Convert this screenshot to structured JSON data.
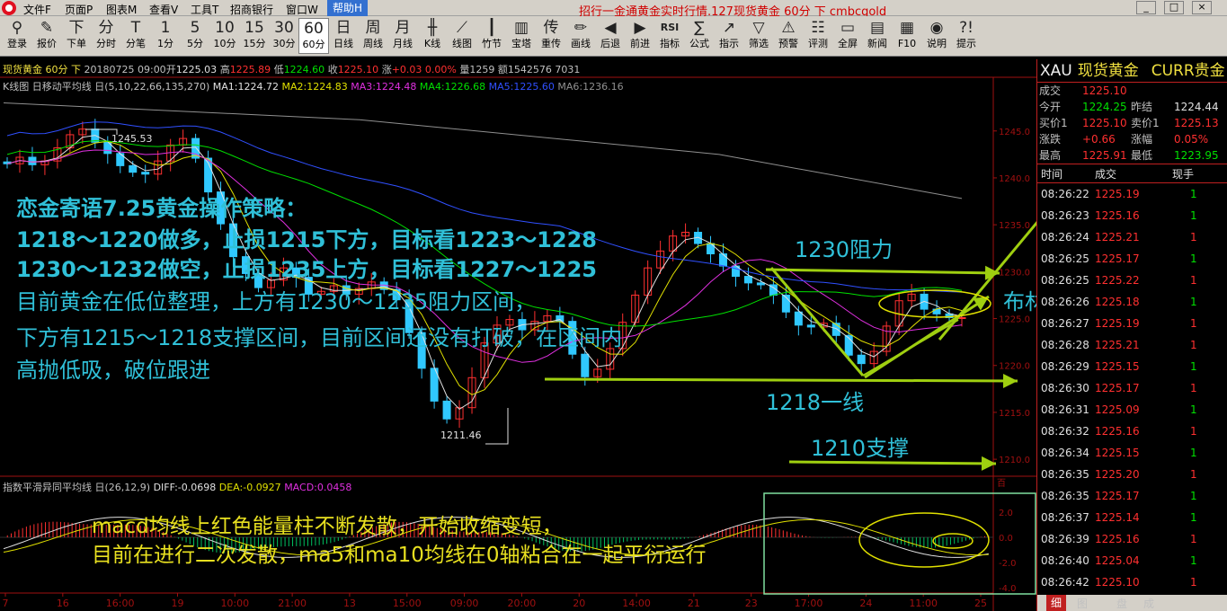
{
  "menubar": {
    "items": [
      "文件F",
      "页面P",
      "图表M",
      "查看V",
      "工具T",
      "招商银行",
      "窗口W"
    ],
    "help": "帮助H",
    "window_title": "招行一金通黄金实时行情.127现货黄金 60分 下 cmbcgold",
    "win_btns": [
      "_",
      "□",
      "×"
    ]
  },
  "toolbar": [
    {
      "icon": "login-icon",
      "glyph": "⚲",
      "label": "登录"
    },
    {
      "icon": "quote-icon",
      "glyph": "✎",
      "label": "报价"
    },
    {
      "icon": "order-icon",
      "glyph": "下",
      "label": "下单"
    },
    {
      "icon": "minute-icon",
      "glyph": "分",
      "label": "分时"
    },
    {
      "icon": "tick-icon",
      "glyph": "T",
      "label": "分笔"
    },
    {
      "icon": "1min-icon",
      "glyph": "1",
      "label": "1分"
    },
    {
      "icon": "5min-icon",
      "glyph": "5",
      "label": "5分"
    },
    {
      "icon": "10min-icon",
      "glyph": "10",
      "label": "10分"
    },
    {
      "icon": "15min-icon",
      "glyph": "15",
      "label": "15分"
    },
    {
      "icon": "30min-icon",
      "glyph": "30",
      "label": "30分"
    },
    {
      "icon": "60min-icon",
      "glyph": "60",
      "label": "60分",
      "active": true
    },
    {
      "icon": "day-icon",
      "glyph": "日",
      "label": "日线"
    },
    {
      "icon": "week-icon",
      "glyph": "周",
      "label": "周线"
    },
    {
      "icon": "month-icon",
      "glyph": "月",
      "label": "月线"
    },
    {
      "icon": "kline-icon",
      "glyph": "╫",
      "label": "K线"
    },
    {
      "icon": "line-icon",
      "glyph": "⟋",
      "label": "线图"
    },
    {
      "icon": "bamboo-icon",
      "glyph": "┃",
      "label": "竹节"
    },
    {
      "icon": "tower-icon",
      "glyph": "▥",
      "label": "宝塔"
    },
    {
      "icon": "retransmit-icon",
      "glyph": "传",
      "label": "重传"
    },
    {
      "icon": "draw-icon",
      "glyph": "✏",
      "label": "画线"
    },
    {
      "icon": "back-icon",
      "glyph": "◀",
      "label": "后退"
    },
    {
      "icon": "forward-icon",
      "glyph": "▶",
      "label": "前进"
    },
    {
      "icon": "indicator-icon",
      "glyph": "RSI",
      "label": "指标"
    },
    {
      "icon": "formula-icon",
      "glyph": "∑",
      "label": "公式"
    },
    {
      "icon": "guide-icon",
      "glyph": "↗",
      "label": "指示"
    },
    {
      "icon": "filter-icon",
      "glyph": "▽",
      "label": "筛选"
    },
    {
      "icon": "alert-icon",
      "glyph": "⚠",
      "label": "预警"
    },
    {
      "icon": "review-icon",
      "glyph": "☷",
      "label": "评测"
    },
    {
      "icon": "fullscreen-icon",
      "glyph": "▭",
      "label": "全屏"
    },
    {
      "icon": "news-icon",
      "glyph": "▤",
      "label": "新闻"
    },
    {
      "icon": "f10-icon",
      "glyph": "▦",
      "label": "F10"
    },
    {
      "icon": "explain-icon",
      "glyph": "◉",
      "label": "说明"
    },
    {
      "icon": "prompt-icon",
      "glyph": "?!",
      "label": "提示"
    }
  ],
  "chart_info": {
    "quote_line": {
      "name": "现货黄金 60分 下",
      "datetime": "20180725 09:00",
      "open_label": "开",
      "open": "1225.03",
      "high_label": "高",
      "high": "1225.89",
      "low_label": "低",
      "low": "1224.60",
      "close_label": "收",
      "close": "1225.10",
      "change_label": "涨",
      "change": "+0.03",
      "pct": "0.00%",
      "vol_label": "量",
      "vol": "1259",
      "amt_label": "额",
      "amt": "1542576",
      "oi": "7031"
    },
    "ma_line": {
      "prefix": "K线图 日移动平均线 日(5,10,22,66,135,270)",
      "ma1": "MA1:1224.72",
      "ma2": "MA2:1224.83",
      "ma3": "MA3:1224.48",
      "ma4": "MA4:1226.68",
      "ma5": "MA5:1225.60",
      "ma6": "MA6:1236.16"
    },
    "macd_line": {
      "prefix": "指数平滑异同平均线 日(26,12,9)",
      "diff": "DIFF:-0.0698",
      "dea": "DEA:-0.0927",
      "macd": "MACD:0.0458"
    }
  },
  "chart_labels": {
    "high_marker": "1245.53",
    "low_marker": "1211.46",
    "price_ticks": [
      "1245.0",
      "1240.0",
      "1235.0",
      "1230.0",
      "1225.0",
      "1220.0",
      "1215.0",
      "1210.0"
    ],
    "macd_ticks": [
      "2.0",
      "0.0",
      "-2.0",
      "-4.0"
    ],
    "macd_unit": "百",
    "x_ticks": [
      "7",
      "16",
      "16:00",
      "19",
      "10:00",
      "21:00",
      "13",
      "15:00",
      "09:00",
      "20:00",
      "20",
      "14:00",
      "21",
      "23",
      "17:00",
      "24",
      "11:00",
      "25"
    ]
  },
  "strategy": [
    "恋金寄语7.25黄金操作策略：",
    "1218～1220做多，止损1215下方，目标看1223～1228",
    "1230～1232做空，止损1235上方，目标看1227～1225",
    "目前黄金在低位整理，上方有1230～1235阻力区间，",
    "下方有1215～1218支撑区间，目前区间还没有打破，在区间内",
    "高抛低吸，破位跟进"
  ],
  "annotations": {
    "resistance": "1230阻力",
    "support_1218": "1218一线",
    "support_1210": "1210支撑",
    "boll": "布林线平行运行"
  },
  "macd_note": [
    "macd均线上红色能量柱不断发散，开始收缩变短，",
    "目前在进行二次发散，ma5和ma10均线在0轴粘合在一起平衍运行"
  ],
  "quote_panel": {
    "code": "XAU",
    "name": "现货黄金",
    "category": "CURR贵金",
    "last_label": "成交",
    "last": "1225.10",
    "open_label": "今开",
    "open": "1224.25",
    "prev_label": "昨结",
    "prev": "1224.44",
    "bid_label": "买价1",
    "bid": "1225.10",
    "ask_label": "卖价1",
    "ask": "1225.13",
    "chg_label": "涨跌",
    "chg": "+0.66",
    "amp_label": "涨幅",
    "amp": "0.05%",
    "high_label": "最高",
    "high": "1225.91",
    "low_label": "最低",
    "low": "1223.95",
    "tick_headers": [
      "时间",
      "成交",
      "现手"
    ],
    "ticks": [
      {
        "time": "08:26:22",
        "price": "1225.19",
        "vol": "1",
        "dir": "green"
      },
      {
        "time": "08:26:23",
        "price": "1225.16",
        "vol": "1",
        "dir": "green"
      },
      {
        "time": "08:26:24",
        "price": "1225.21",
        "vol": "1",
        "dir": "red"
      },
      {
        "time": "08:26:25",
        "price": "1225.17",
        "vol": "1",
        "dir": "green"
      },
      {
        "time": "08:26:25",
        "price": "1225.22",
        "vol": "1",
        "dir": "red"
      },
      {
        "time": "08:26:26",
        "price": "1225.18",
        "vol": "1",
        "dir": "green"
      },
      {
        "time": "08:26:27",
        "price": "1225.19",
        "vol": "1",
        "dir": "red"
      },
      {
        "time": "08:26:28",
        "price": "1225.21",
        "vol": "1",
        "dir": "red"
      },
      {
        "time": "08:26:29",
        "price": "1225.15",
        "vol": "1",
        "dir": "green"
      },
      {
        "time": "08:26:30",
        "price": "1225.17",
        "vol": "1",
        "dir": "red"
      },
      {
        "time": "08:26:31",
        "price": "1225.09",
        "vol": "1",
        "dir": "green"
      },
      {
        "time": "08:26:32",
        "price": "1225.16",
        "vol": "1",
        "dir": "red"
      },
      {
        "time": "08:26:34",
        "price": "1225.15",
        "vol": "1",
        "dir": "green"
      },
      {
        "time": "08:26:35",
        "price": "1225.20",
        "vol": "1",
        "dir": "red"
      },
      {
        "time": "08:26:35",
        "price": "1225.17",
        "vol": "1",
        "dir": "green"
      },
      {
        "time": "08:26:37",
        "price": "1225.14",
        "vol": "1",
        "dir": "green"
      },
      {
        "time": "08:26:39",
        "price": "1225.16",
        "vol": "1",
        "dir": "red"
      },
      {
        "time": "08:26:40",
        "price": "1225.04",
        "vol": "1",
        "dir": "green"
      },
      {
        "time": "08:26:42",
        "price": "1225.10",
        "vol": "1",
        "dir": "red"
      }
    ],
    "tabs": [
      "细",
      "图",
      "盘",
      "成"
    ]
  },
  "colors": {
    "up": "#ff3030",
    "down": "#30c8ff",
    "ma1": "#e0e0e0",
    "ma2": "#e0e000",
    "ma3": "#e030e0",
    "ma4": "#00e000",
    "ma5": "#3050ff",
    "ma6": "#909090",
    "arrow": "#9fcf10",
    "grid_red": "#a01010"
  },
  "chart_data": {
    "type": "candlestick",
    "title": "现货黄金 60分",
    "ylim": [
      1208,
      1249
    ],
    "series": [
      {
        "name": "K线",
        "values": [
          1241.5,
          1242.2,
          1241.4,
          1241.8,
          1243.2,
          1244.6,
          1245.2,
          1243.8,
          1242.6,
          1241.3,
          1240.6,
          1240.4,
          1241.8,
          1243.5,
          1244.2,
          1242.1,
          1238.5,
          1235.1,
          1231.6,
          1229.8,
          1228.3,
          1229.1,
          1230.4,
          1229.4,
          1227.6,
          1227.9,
          1228.5,
          1227.6,
          1228.2,
          1228.9,
          1228.1,
          1227.0,
          1223.5,
          1219.7,
          1216.2,
          1214.3,
          1215.5,
          1218.7,
          1222.4,
          1224.3,
          1224.9,
          1223.8,
          1224.7,
          1225.3,
          1224.7,
          1221.2,
          1218.8,
          1219.6,
          1221.8,
          1224.6,
          1227.5,
          1230.4,
          1232.2,
          1233.8,
          1234.2,
          1233.0,
          1231.9,
          1230.6,
          1229.5,
          1228.8,
          1228.6,
          1227.5,
          1225.7,
          1224.3,
          1224.1,
          1224.5,
          1223.2,
          1221.1,
          1220.2,
          1221.5,
          1224.2,
          1226.9,
          1227.6,
          1226.0,
          1225.5,
          1225.1,
          1225.1
        ]
      }
    ]
  }
}
